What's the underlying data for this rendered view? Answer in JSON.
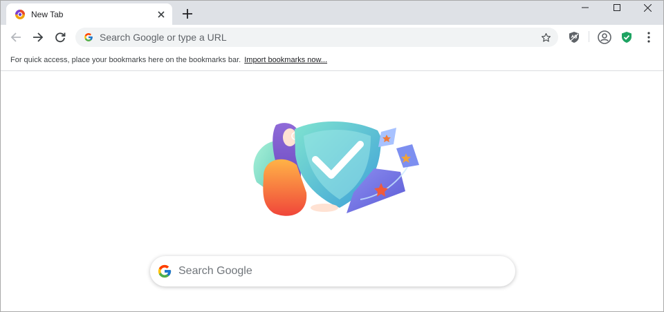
{
  "tab": {
    "title": "New Tab",
    "icon": "browser-logo-icon"
  },
  "toolbar": {
    "omnibox_placeholder": "Search Google or type a URL"
  },
  "bookmarks_bar": {
    "message": "For quick access, place your bookmarks here on the bookmarks bar.",
    "import_link": "Import bookmarks now..."
  },
  "ntp": {
    "search_placeholder": "Search Google"
  },
  "colors": {
    "tabstrip": "#dee1e6",
    "omnibox": "#f1f3f4",
    "shield_green": "#1ea362"
  }
}
